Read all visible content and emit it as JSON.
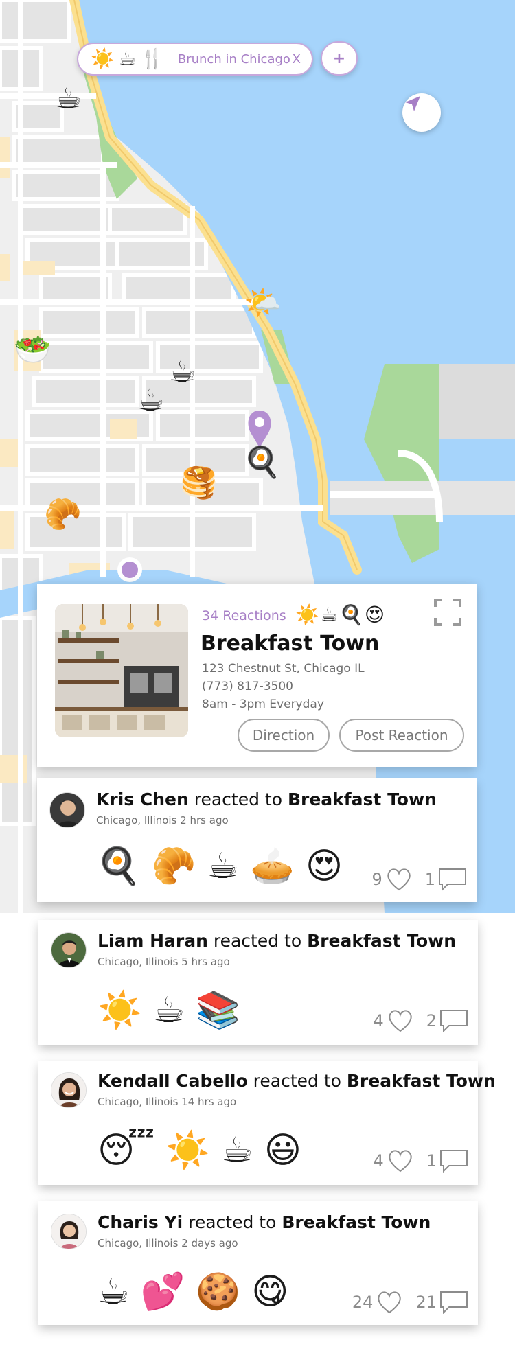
{
  "filter": {
    "icons": [
      "☀️",
      "☕",
      "🍴"
    ],
    "label": "Brunch in Chicago",
    "clear": "X",
    "add": "+"
  },
  "map_markers": [
    {
      "name": "coffee-marker-1",
      "emoji": "☕"
    },
    {
      "name": "weather-marker",
      "emoji": "🌤️"
    },
    {
      "name": "salad-marker",
      "emoji": "🥗"
    },
    {
      "name": "coffee-marker-2",
      "emoji": "☕"
    },
    {
      "name": "coffee-marker-3",
      "emoji": "☕"
    },
    {
      "name": "egg-pan-marker",
      "emoji": "🍳"
    },
    {
      "name": "pancakes-marker",
      "emoji": "🥞"
    },
    {
      "name": "croissant-marker",
      "emoji": "🥐"
    }
  ],
  "place": {
    "reactions": "34 Reactions",
    "reaction_emojis": "☀️☕🍳😍",
    "name": "Breakfast Town",
    "address": "123 Chestnut St, Chicago IL",
    "phone": "(773) 817-3500",
    "hours": "8am - 3pm Everyday",
    "direction_label": "Direction",
    "post_label": "Post Reaction"
  },
  "activity": [
    {
      "user": "Kris Chen",
      "verb": "reacted to",
      "place": "Breakfast Town",
      "meta": "Chicago, Illinois 2 hrs ago",
      "emojis": [
        "🍳",
        "🥐",
        "☕",
        "🥧",
        "😍"
      ],
      "likes": "9",
      "comments": "1"
    },
    {
      "user": "Liam Haran",
      "verb": "reacted to",
      "place": "Breakfast Town",
      "meta": "Chicago, Illinois 5 hrs ago",
      "emojis": [
        "☀️",
        "☕",
        "📚"
      ],
      "likes": "4",
      "comments": "2"
    },
    {
      "user": "Kendall Cabello",
      "verb": "reacted to",
      "place": "Breakfast Town",
      "meta": "Chicago, Illinois 14 hrs ago",
      "emojis": [
        "😴",
        "☀️",
        "☕",
        "😃"
      ],
      "likes": "4",
      "comments": "1"
    },
    {
      "user": "Charis Yi",
      "verb": "reacted to",
      "place": "Breakfast Town",
      "meta": "Chicago, Illinois 2 days ago",
      "emojis": [
        "☕",
        "💕",
        "🍪",
        "😋"
      ],
      "likes": "24",
      "comments": "21"
    }
  ],
  "colors": {
    "accent": "#a77fc6",
    "water": "#a6d4fb",
    "park": "#a9d89a",
    "highway": "#fbe08f",
    "land": "#efefef"
  }
}
